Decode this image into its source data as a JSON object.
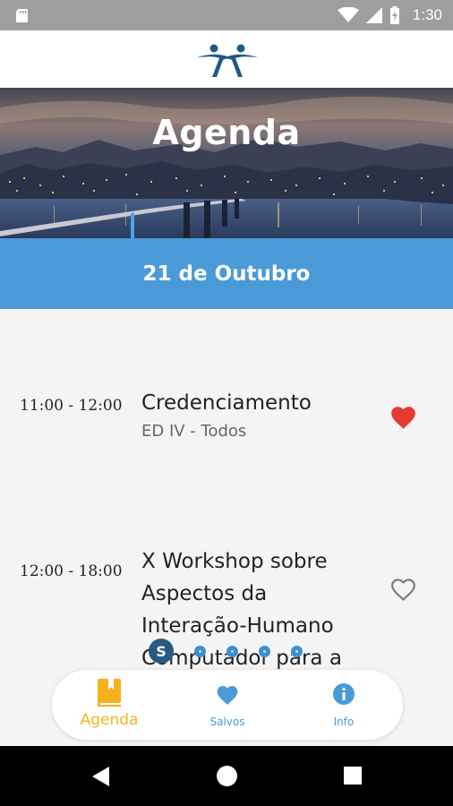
{
  "status_bar": {
    "time": "1:30"
  },
  "header": {
    "logo_icon": "conference-logo-icon"
  },
  "hero": {
    "title": "Agenda"
  },
  "date_bar": {
    "label": "21 de Outubro"
  },
  "events": [
    {
      "time": "11:00 - 12:00",
      "title_lines": [
        "Credenciamento"
      ],
      "location": "ED IV - Todos",
      "saved": true
    },
    {
      "time": "12:00 - 18:00",
      "title_lines": [
        "X Workshop sobre",
        "Aspectos da",
        "Interação-Humano",
        "Computador para a"
      ],
      "location": "",
      "saved": false
    }
  ],
  "pager": {
    "active_label": "S",
    "dot_count": 5
  },
  "bottom_nav": {
    "items": [
      {
        "label": "Agenda",
        "icon": "book-icon",
        "active": true
      },
      {
        "label": "Salvos",
        "icon": "heart-icon",
        "active": false
      },
      {
        "label": "Info",
        "icon": "info-icon",
        "active": false
      }
    ]
  },
  "colors": {
    "primary_blue": "#4a9ad8",
    "accent_yellow": "#f5b21b",
    "heart_red": "#e53935"
  }
}
